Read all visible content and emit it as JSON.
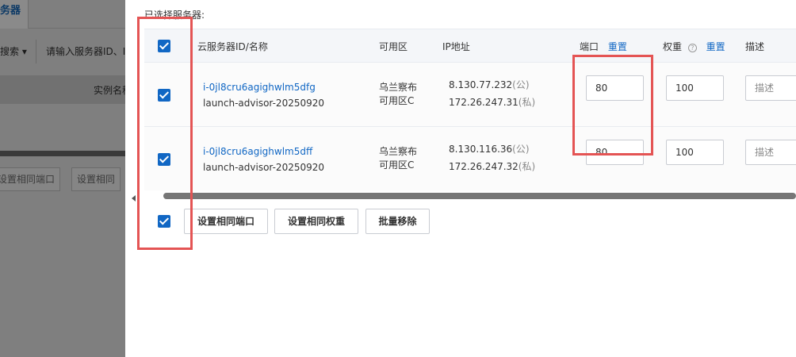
{
  "background": {
    "tab_label": "务器",
    "search_dropdown": "搜索 ▾",
    "search_placeholder": "请输入服务器ID、I",
    "column_header": "实例名称",
    "buttons": [
      "设置相同端口",
      "设置相同"
    ]
  },
  "drawer": {
    "section_title": "已选择服务器:",
    "columns": {
      "server": "云服务器ID/名称",
      "zone": "可用区",
      "ip": "IP地址",
      "port": "端口",
      "port_reset": "重置",
      "weight": "权重",
      "weight_reset": "重置",
      "desc": "描述"
    },
    "rows": [
      {
        "id": "i-0jl8cru6agighwlm5dfg",
        "name": "launch-advisor-20250920",
        "zone_line1": "乌兰察布",
        "zone_line2": "可用区C",
        "public_ip": "8.130.77.232",
        "public_tag": "(公)",
        "private_ip": "172.26.247.31",
        "private_tag": "(私)",
        "port": "80",
        "weight": "100",
        "desc_placeholder": "描述"
      },
      {
        "id": "i-0jl8cru6agighwlm5dff",
        "name": "launch-advisor-20250920",
        "zone_line1": "乌兰察布",
        "zone_line2": "可用区C",
        "public_ip": "8.130.116.36",
        "public_tag": "(公)",
        "private_ip": "172.26.247.32",
        "private_tag": "(私)",
        "port": "80",
        "weight": "100",
        "desc_placeholder": "描述"
      }
    ],
    "actions": {
      "same_port": "设置相同端口",
      "same_weight": "设置相同权重",
      "bulk_remove": "批量移除"
    }
  },
  "colors": {
    "accent": "#1167c4",
    "highlight": "#e45454"
  }
}
